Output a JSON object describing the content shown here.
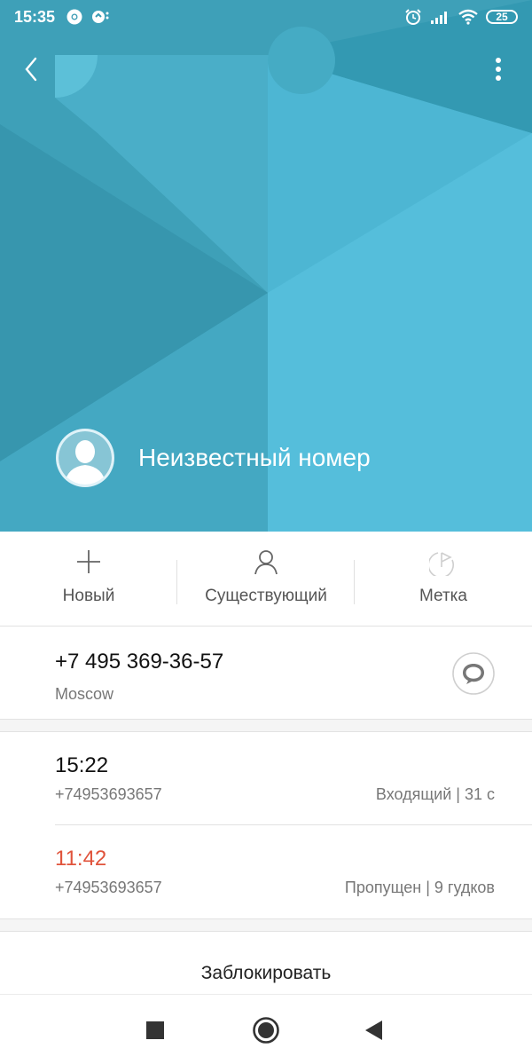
{
  "status_bar": {
    "time": "15:35",
    "battery": "25",
    "icons": [
      "chrome-icon",
      "notification-icon",
      "alarm-icon",
      "signal-icon",
      "wifi-icon",
      "battery-icon"
    ]
  },
  "header": {
    "contact_name": "Неизвестный номер",
    "colors": {
      "base": "#3ea0b8",
      "light": "#55bedb",
      "dark": "#2d8fa8"
    }
  },
  "actions": [
    {
      "label": "Новый",
      "icon": "plus-icon"
    },
    {
      "label": "Существующий",
      "icon": "person-icon"
    },
    {
      "label": "Метка",
      "icon": "tag-flag-icon"
    }
  ],
  "phone": {
    "number": "+7 495 369-36-57",
    "location": "Moscow"
  },
  "calls": [
    {
      "time": "15:22",
      "number": "+74953693657",
      "info": "Входящий | 31 с",
      "missed": false
    },
    {
      "time": "11:42",
      "number": "+74953693657",
      "info": "Пропущен | 9 гудков",
      "missed": true
    }
  ],
  "block_label": "Заблокировать",
  "nav": [
    "recents-square-icon",
    "home-circle-icon",
    "back-triangle-icon"
  ],
  "colors": {
    "missed": "#e0533b",
    "text": "#111111",
    "secondary": "#777777"
  }
}
